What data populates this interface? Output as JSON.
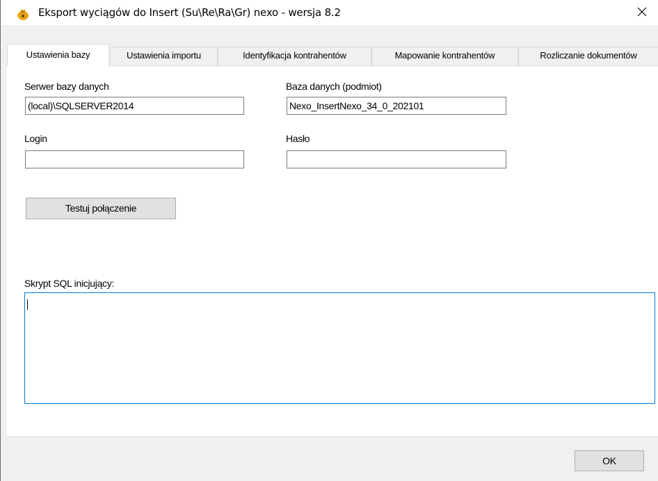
{
  "window": {
    "title": "Eksport wyciągów do Insert (Su\\Re\\Ra\\Gr) nexo - wersja 8.2",
    "app_icon": "money-bag-icon",
    "close_icon": "close-icon"
  },
  "tabs": [
    {
      "label": "Ustawienia bazy",
      "active": true
    },
    {
      "label": "Ustawienia importu",
      "active": false
    },
    {
      "label": "Identyfikacja kontrahentów",
      "active": false
    },
    {
      "label": "Mapowanie kontrahentów",
      "active": false
    },
    {
      "label": "Rozliczanie dokumentów",
      "active": false
    }
  ],
  "form": {
    "server_label": "Serwer bazy danych",
    "server_value": "(local)\\SQLSERVER2014",
    "database_label": "Baza danych (podmiot)",
    "database_value": "Nexo_InsertNexo_34_0_202101",
    "login_label": "Login",
    "login_value": "",
    "password_label": "Hasło",
    "password_value": "",
    "test_button": "Testuj połączenie",
    "sql_label": "Skrypt SQL inicjujący:",
    "sql_value": ""
  },
  "footer": {
    "ok_button": "OK"
  },
  "colors": {
    "accent": "#0078d7",
    "window_bg": "#f0f0f0",
    "panel_bg": "#ffffff"
  }
}
